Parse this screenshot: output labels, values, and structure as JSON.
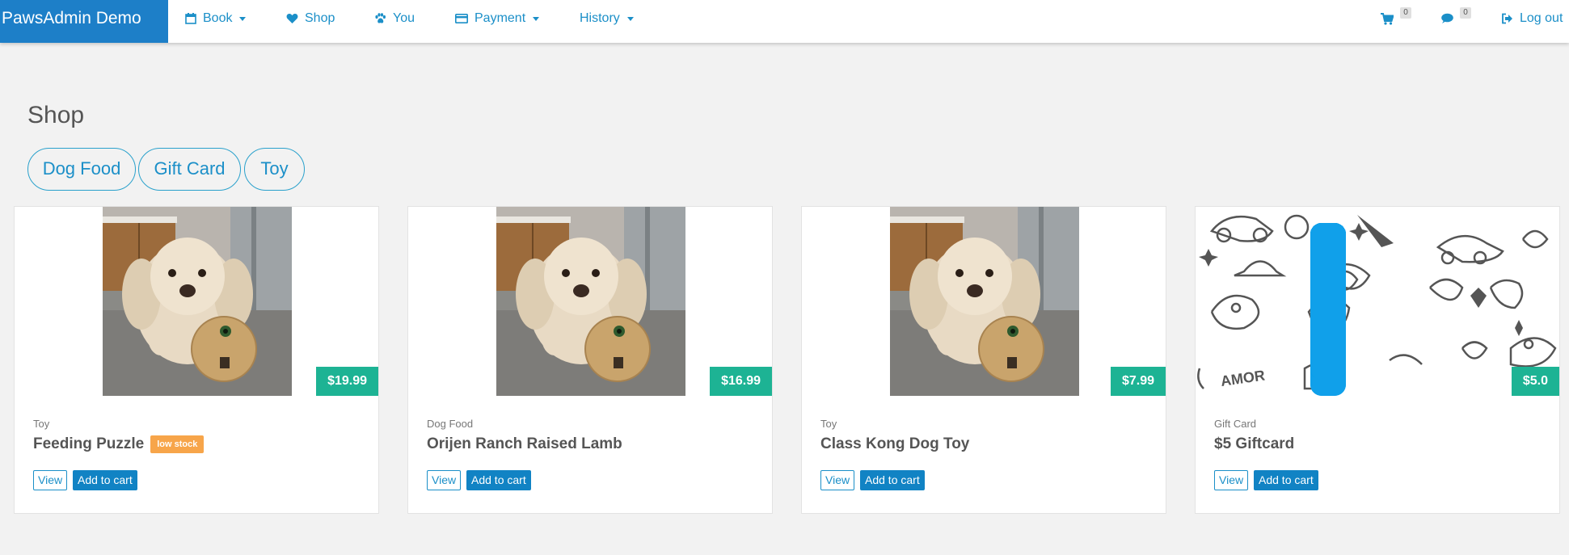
{
  "brand": "PawsAdmin Demo",
  "nav": {
    "book": "Book",
    "shop": "Shop",
    "you": "You",
    "payment": "Payment",
    "history": "History",
    "cart_count": "0",
    "messages_count": "0",
    "logout": "Log out"
  },
  "page_title": "Shop",
  "filters": [
    "Dog Food",
    "Gift Card",
    "Toy"
  ],
  "products": [
    {
      "category": "Toy",
      "name": "Feeding Puzzle",
      "badge": "low stock",
      "price": "$19.99",
      "image": "dog-with-ball"
    },
    {
      "category": "Dog Food",
      "name": "Orijen Ranch Raised Lamb",
      "price": "$16.99",
      "image": "dog-with-ball"
    },
    {
      "category": "Toy",
      "name": "Class Kong Dog Toy",
      "price": "$7.99",
      "image": "dog-with-ball"
    },
    {
      "category": "Gift Card",
      "name": "$5 Giftcard",
      "price": "$5.0",
      "image": "giftcard-plus"
    }
  ],
  "buttons": {
    "view": "View",
    "add_to_cart": "Add to cart"
  },
  "giftcard_doodle_text": "AMOR",
  "colors": {
    "brand": "#1d7fc8",
    "link": "#1b8fc8",
    "price": "#1db394",
    "low_stock": "#f7a54a",
    "primary_button": "#1183c4",
    "giftcard_plus": "#10a0ea"
  }
}
